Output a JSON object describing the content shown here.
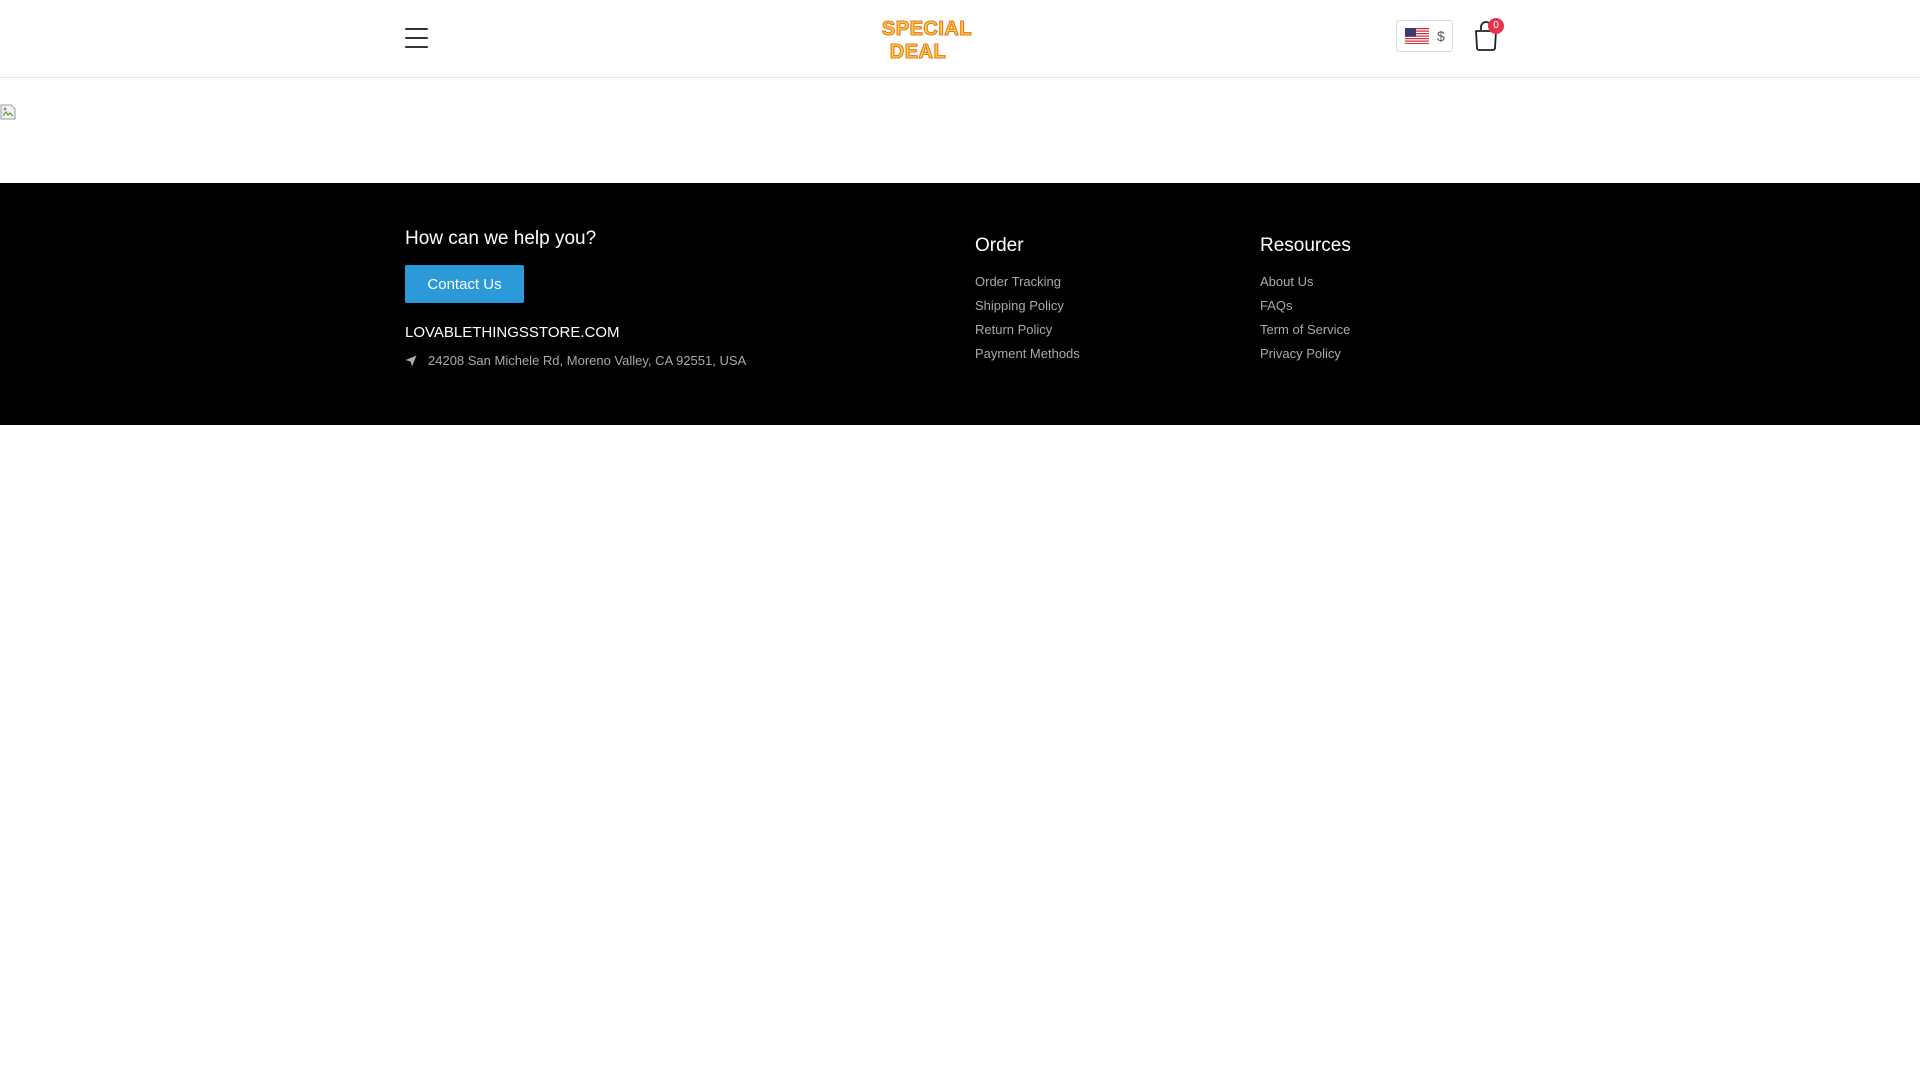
{
  "header": {
    "menu_icon": "hamburger-menu-icon",
    "logo": {
      "line1": "SPECIAL",
      "line2": "DEAL",
      "color": "#f5a623"
    },
    "currency": {
      "flag": "us-flag-icon",
      "symbol": "$"
    },
    "cart": {
      "icon": "shopping-bag-icon",
      "count": "0",
      "badge_color": "#e4344e"
    }
  },
  "banner": {
    "icon": "broken-image-icon"
  },
  "footer": {
    "help_title": "How can we help you?",
    "contact_label": "Contact Us",
    "store_name": "LOVABLETHINGSSTORE.COM",
    "address": "24208 San Michele Rd, Moreno Valley, CA 92551, USA",
    "address_icon": "location-arrow-icon",
    "order": {
      "title": "Order",
      "links": [
        "Order Tracking",
        "Shipping Policy",
        "Return Policy",
        "Payment Methods"
      ]
    },
    "resources": {
      "title": "Resources",
      "links": [
        "About Us",
        "FAQs",
        "Term of Service",
        "Privacy Policy"
      ]
    },
    "button_color": "#2c9ad8",
    "background": "#000000"
  }
}
